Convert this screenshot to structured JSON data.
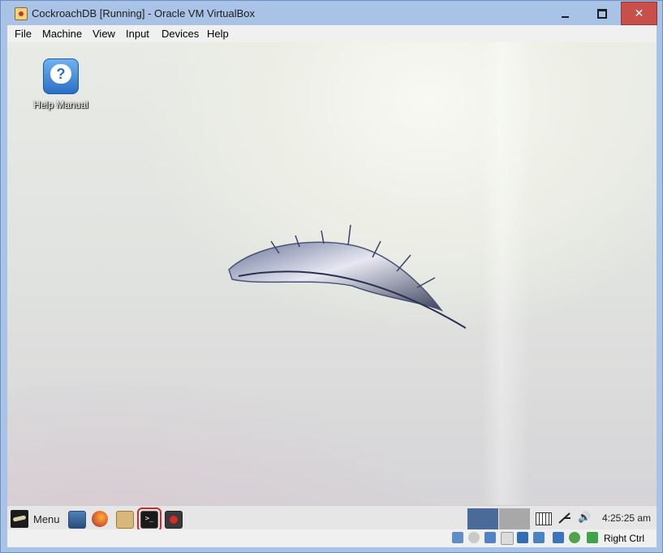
{
  "window": {
    "title": "CockroachDB [Running] - Oracle VM VirtualBox",
    "controls": [
      "minimize-icon",
      "maximize-icon",
      "close-icon"
    ],
    "close_glyph": "✕"
  },
  "menubar": {
    "items": [
      "File",
      "Machine",
      "View",
      "Input",
      "Devices",
      "Help"
    ]
  },
  "desktop": {
    "icons": [
      {
        "label": "Help Manual",
        "icon": "help-icon"
      }
    ],
    "wallpaper": "feather"
  },
  "panel": {
    "menu_label": "Menu",
    "launchers": [
      "display-settings-icon",
      "firefox-icon",
      "home-folder-icon",
      "terminal-icon",
      "record-icon"
    ],
    "terminal_glyph": ">_",
    "workspaces": 2,
    "clock": "4:25:25 am"
  },
  "statusbar": {
    "icons": [
      "hard-disk-icon",
      "optical-drive-icon",
      "network-icon",
      "shared-folders-icon",
      "display-icon",
      "video-capture-icon",
      "cpu-icon",
      "usb-icon",
      "mouse-integration-icon"
    ],
    "host_key": "Right Ctrl"
  },
  "colors": {
    "frame": "#a9c3e6",
    "close_button": "#c7504b",
    "terminal_highlight": "#d9262a",
    "workspace_active": "#4a6a9a"
  }
}
